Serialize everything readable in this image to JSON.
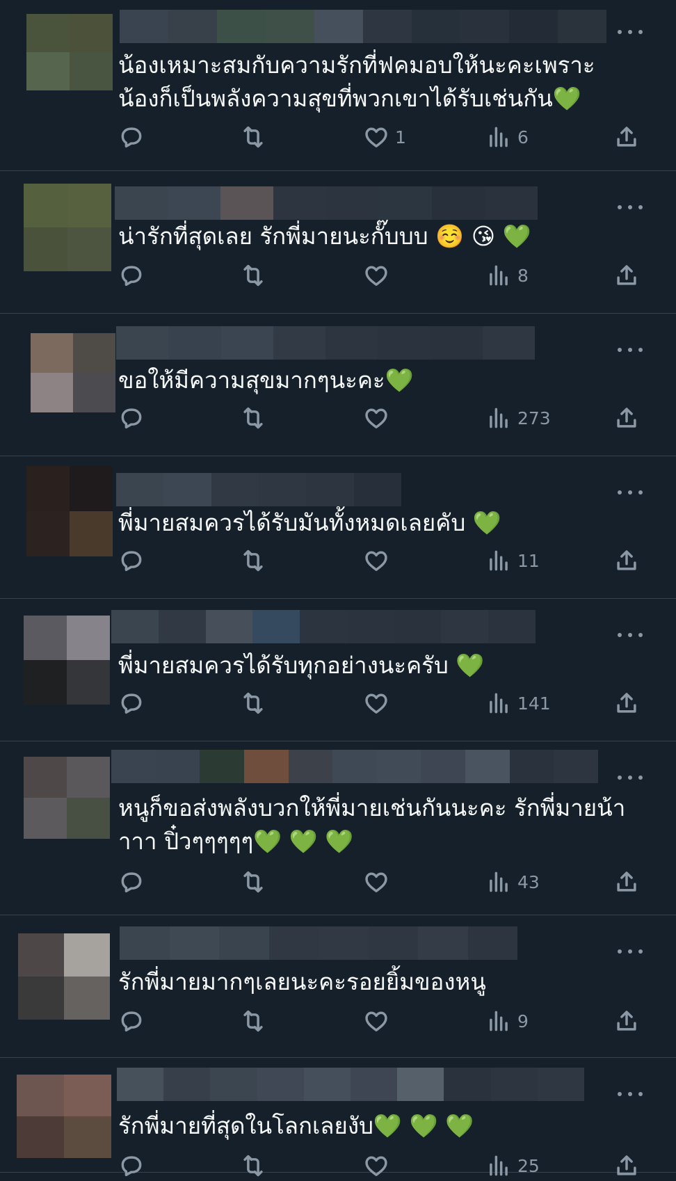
{
  "colors": {
    "background": "#15202b",
    "divider": "#38444d",
    "text": "#f7f9f9",
    "muted": "#8b98a5"
  },
  "icons": {
    "reply": "comment-bubble-icon",
    "retweet": "retweet-arrows-icon",
    "like": "heart-icon",
    "views": "bar-chart-icon",
    "share": "share-upload-icon",
    "more": "ellipsis-icon"
  },
  "replies": [
    {
      "text": "น้องเหมาะสมกับความรักที่ฟคมอบให้นะคะเพราะ\nน้องก็เป็นพลังความสุขที่พวกเขาได้รับเช่นกัน💚",
      "likes": "1",
      "views": "6"
    },
    {
      "text": "น่ารักที่สุดเลย รักพี่มายนะกั๊บบบ ☺️ 😘 💚",
      "likes": "",
      "views": "8"
    },
    {
      "text": "ขอให้มีความสุขมากๆนะคะ💚",
      "likes": "",
      "views": "273"
    },
    {
      "text": "พี่มายสมควรได้รับมันทั้งหมดเลยคับ 💚",
      "likes": "",
      "views": "11"
    },
    {
      "text": "พี่มายสมควรได้รับทุกอย่างนะครับ 💚",
      "likes": "",
      "views": "141"
    },
    {
      "text": "หนูก็ขอส่งพลังบวกให้พี่มายเช่นกันนะคะ รักพี่มายน้า\nาาา ปิ๋วๆๆๆๆๆ💚 💚 💚",
      "likes": "",
      "views": "43"
    },
    {
      "text": "รักพี่มายมากๆเลยนะคะรอยยิ้มของหนู",
      "likes": "",
      "views": "9"
    },
    {
      "text": "รักพี่มายที่สุดในโลกเลยงับ💚 💚 💚",
      "likes": "",
      "views": "25"
    }
  ]
}
